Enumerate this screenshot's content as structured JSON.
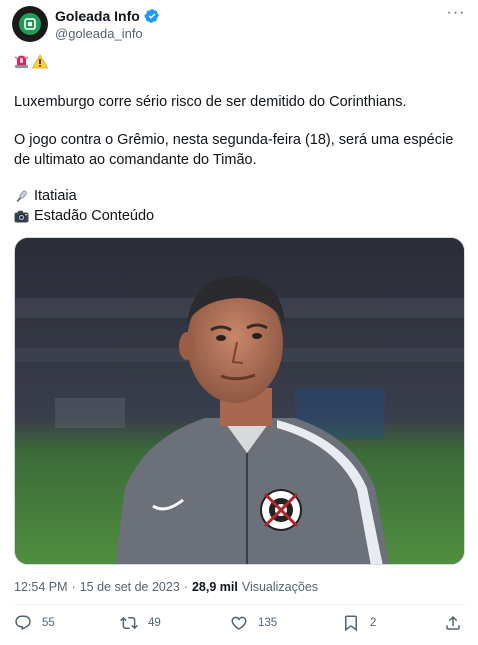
{
  "author": {
    "display_name": "Goleada Info",
    "handle": "@goleada_info"
  },
  "tweet": {
    "emojis": [
      "police-light",
      "warning"
    ],
    "paragraph1": "Luxemburgo corre sério risco de ser demitido do Corinthians.",
    "paragraph2": "O jogo contra o Grêmio, nesta segunda-feira (18), será uma espécie de ultimato ao comandante do Timão.",
    "credit_radio": "Itatiaia",
    "credit_photo": "Estadão Conteúdo"
  },
  "meta": {
    "time": "12:54 PM",
    "separator1": "·",
    "date": "15 de set de 2023",
    "separator2": "·",
    "views_count": "28,9 mil",
    "views_label": "Visualizações"
  },
  "actions": {
    "replies": "55",
    "retweets": "49",
    "likes": "135",
    "bookmarks": "2"
  },
  "colors": {
    "text": "#0f1419",
    "secondary": "#536471",
    "verified": "#1d9bf0",
    "divider": "#eff3f4"
  }
}
